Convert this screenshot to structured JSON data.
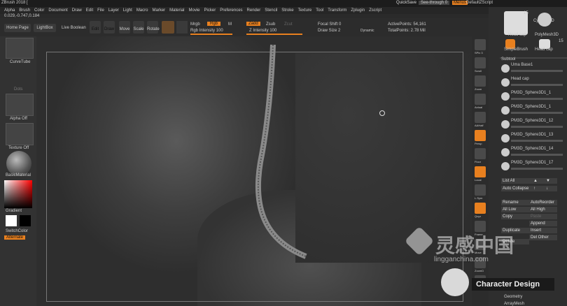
{
  "app": {
    "title": "ZBrush 2018 [",
    "quicksave": "QuickSave",
    "see_through": "See-through   0",
    "menus": "Menus",
    "script": "DefaultZScript"
  },
  "menu": [
    "Alpha",
    "Brush",
    "Color",
    "Document",
    "Draw",
    "Edit",
    "File",
    "Layer",
    "Light",
    "Macro",
    "Marker",
    "Material",
    "Movie",
    "Picker",
    "Preferences",
    "Render",
    "Stencil",
    "Stroke",
    "Texture",
    "Tool",
    "Transform",
    "Zplugin",
    "Zscript"
  ],
  "coords": "0.029,-0.747,0.184",
  "toolbar": {
    "home": "Home Page",
    "lightbox": "LightBox",
    "live": "Live Boolean",
    "edit": "Edit",
    "draw": "Draw",
    "move": "Move",
    "scale": "Scale",
    "rotate": "Rotate",
    "mrgb": "Mrgb",
    "rgb": "Rgb",
    "m": "M",
    "rgb_intensity": "Rgb Intensity 100",
    "zadd": "Zadd",
    "zsub": "Zsub",
    "zcut": "Zcut",
    "z_intensity": "Z Intensity 100",
    "focal": "Focal Shift 0",
    "draw_size": "Draw Size 2",
    "dynamic": "Dynamic",
    "active_points": "ActivePoints: 54,161",
    "total_points": "TotalPoints: 2.78 Mil"
  },
  "left": {
    "brush": "CurveTube",
    "dots": "Dots",
    "alpha": "Alpha Off",
    "texture": "Texture Off",
    "material": "BasicMaterial",
    "gradient": "Gradient",
    "switch": "SwitchColor",
    "alternate": "Alternate"
  },
  "shelf": [
    "SPix 3",
    "Scroll",
    "Zoom",
    "Actual",
    "AAHalf",
    "Persp",
    "Floor",
    "Local",
    "L.Sym",
    "Qxyz",
    "Frame",
    "Move",
    "ZoomD",
    "Rotate"
  ],
  "right": {
    "tool_count": "15",
    "cylinder": "Cylinder3D",
    "polymesh": "PolyMesh3D",
    "head_cap": "Head cap",
    "simple_brush": "SimpleBrush",
    "head_cap2": "Head cap",
    "tool_count2": "15",
    "subtool_header": "Subtool",
    "subtools": [
      "Uma Base1",
      "Head cap",
      "PM3D_Sphere3D1_1",
      "PM3D_Sphere3D1_1",
      "PM3D_Sphere3D1_12",
      "PM3D_Sphere3D1_13",
      "PM3D_Sphere3D1_14",
      "PM3D_Sphere3D1_17"
    ],
    "list_all": "List All",
    "auto_collapse": "Auto Collapse",
    "rename": "Rename",
    "autoreorder": "AutoReorder",
    "all_low": "All Low",
    "all_high": "All High",
    "copy": "Copy",
    "paste": "Paste",
    "duplicate": "Duplicate",
    "append": "Append",
    "insert": "Insert",
    "del_other": "Del Other",
    "delete": "Delete",
    "geometry": "Geometry",
    "arraymesh": "ArrayMesh"
  },
  "watermark": {
    "site": "lingganchina.com",
    "cn": "灵感中国",
    "badge": "Character Design"
  }
}
